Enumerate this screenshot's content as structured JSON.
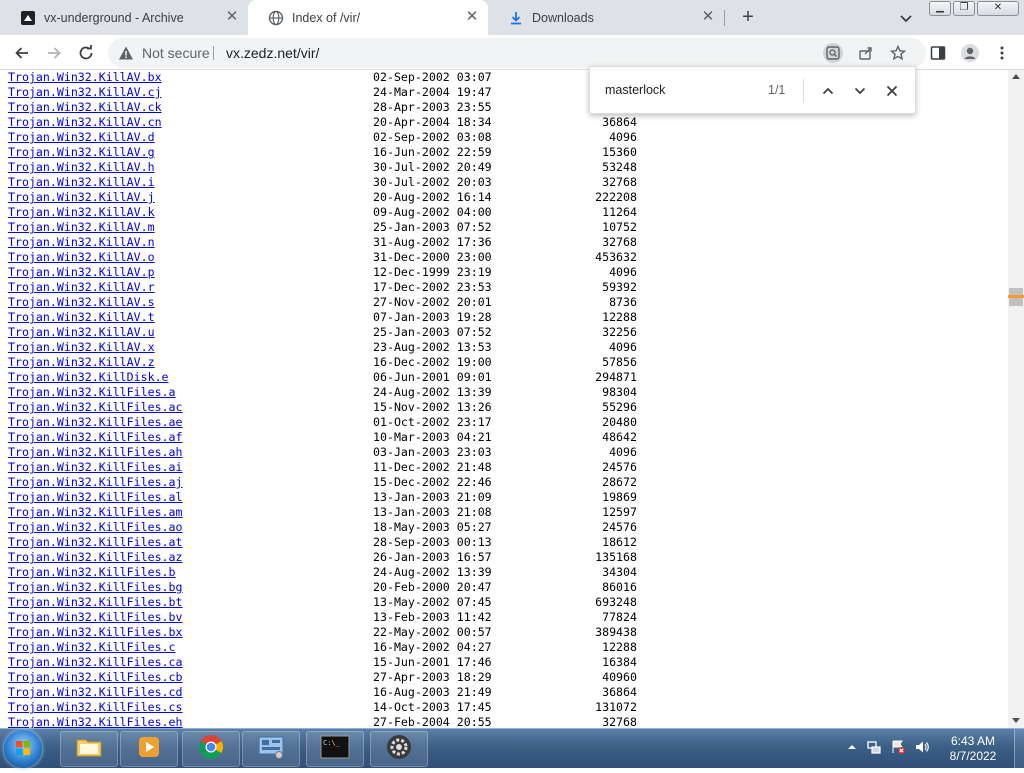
{
  "tabs": [
    {
      "title": "vx-underground - Archive",
      "icon": "vx-favicon",
      "active": false
    },
    {
      "title": "Index of /vir/",
      "icon": "globe-icon",
      "active": true
    },
    {
      "title": "Downloads",
      "icon": "download-icon",
      "active": false
    }
  ],
  "toolbar": {
    "security_text": "Not secure",
    "url": "vx.zedz.net/vir/"
  },
  "findbar": {
    "query": "masterlock",
    "count": "1/1"
  },
  "listing": [
    {
      "name": "Trojan.Win32.KillAV.bx",
      "date": "02-Sep-2002 03:07",
      "size": ""
    },
    {
      "name": "Trojan.Win32.KillAV.cj",
      "date": "24-Mar-2004 19:47",
      "size": ""
    },
    {
      "name": "Trojan.Win32.KillAV.ck",
      "date": "28-Apr-2003 23:55",
      "size": ""
    },
    {
      "name": "Trojan.Win32.KillAV.cn",
      "date": "20-Apr-2004 18:34",
      "size": "36864"
    },
    {
      "name": "Trojan.Win32.KillAV.d",
      "date": "02-Sep-2002 03:08",
      "size": "4096"
    },
    {
      "name": "Trojan.Win32.KillAV.g",
      "date": "16-Jun-2002 22:59",
      "size": "15360"
    },
    {
      "name": "Trojan.Win32.KillAV.h",
      "date": "30-Jul-2002 20:49",
      "size": "53248"
    },
    {
      "name": "Trojan.Win32.KillAV.i",
      "date": "30-Jul-2002 20:03",
      "size": "32768"
    },
    {
      "name": "Trojan.Win32.KillAV.j",
      "date": "20-Aug-2002 16:14",
      "size": "222208"
    },
    {
      "name": "Trojan.Win32.KillAV.k",
      "date": "09-Aug-2002 04:00",
      "size": "11264"
    },
    {
      "name": "Trojan.Win32.KillAV.m",
      "date": "25-Jan-2003 07:52",
      "size": "10752"
    },
    {
      "name": "Trojan.Win32.KillAV.n",
      "date": "31-Aug-2002 17:36",
      "size": "32768"
    },
    {
      "name": "Trojan.Win32.KillAV.o",
      "date": "31-Dec-2000 23:00",
      "size": "453632"
    },
    {
      "name": "Trojan.Win32.KillAV.p",
      "date": "12-Dec-1999 23:19",
      "size": "4096"
    },
    {
      "name": "Trojan.Win32.KillAV.r",
      "date": "17-Dec-2002 23:53",
      "size": "59392"
    },
    {
      "name": "Trojan.Win32.KillAV.s",
      "date": "27-Nov-2002 20:01",
      "size": "8736"
    },
    {
      "name": "Trojan.Win32.KillAV.t",
      "date": "07-Jan-2003 19:28",
      "size": "12288"
    },
    {
      "name": "Trojan.Win32.KillAV.u",
      "date": "25-Jan-2003 07:52",
      "size": "32256"
    },
    {
      "name": "Trojan.Win32.KillAV.x",
      "date": "23-Aug-2002 13:53",
      "size": "4096"
    },
    {
      "name": "Trojan.Win32.KillAV.z",
      "date": "16-Dec-2002 19:00",
      "size": "57856"
    },
    {
      "name": "Trojan.Win32.KillDisk.e",
      "date": "06-Jun-2001 09:01",
      "size": "294871"
    },
    {
      "name": "Trojan.Win32.KillFiles.a",
      "date": "24-Aug-2002 13:39",
      "size": "98304"
    },
    {
      "name": "Trojan.Win32.KillFiles.ac",
      "date": "15-Nov-2002 13:26",
      "size": "55296"
    },
    {
      "name": "Trojan.Win32.KillFiles.ae",
      "date": "01-Oct-2002 23:17",
      "size": "20480"
    },
    {
      "name": "Trojan.Win32.KillFiles.af",
      "date": "10-Mar-2003 04:21",
      "size": "48642"
    },
    {
      "name": "Trojan.Win32.KillFiles.ah",
      "date": "03-Jan-2003 23:03",
      "size": "4096"
    },
    {
      "name": "Trojan.Win32.KillFiles.ai",
      "date": "11-Dec-2002 21:48",
      "size": "24576"
    },
    {
      "name": "Trojan.Win32.KillFiles.aj",
      "date": "15-Dec-2002 22:46",
      "size": "28672"
    },
    {
      "name": "Trojan.Win32.KillFiles.al",
      "date": "13-Jan-2003 21:09",
      "size": "19869"
    },
    {
      "name": "Trojan.Win32.KillFiles.am",
      "date": "13-Jan-2003 21:08",
      "size": "12597"
    },
    {
      "name": "Trojan.Win32.KillFiles.ao",
      "date": "18-May-2003 05:27",
      "size": "24576"
    },
    {
      "name": "Trojan.Win32.KillFiles.at",
      "date": "28-Sep-2003 00:13",
      "size": "18612"
    },
    {
      "name": "Trojan.Win32.KillFiles.az",
      "date": "26-Jan-2003 16:57",
      "size": "135168"
    },
    {
      "name": "Trojan.Win32.KillFiles.b",
      "date": "24-Aug-2002 13:39",
      "size": "34304"
    },
    {
      "name": "Trojan.Win32.KillFiles.bg",
      "date": "20-Feb-2000 20:47",
      "size": "86016"
    },
    {
      "name": "Trojan.Win32.KillFiles.bt",
      "date": "13-May-2002 07:45",
      "size": "693248"
    },
    {
      "name": "Trojan.Win32.KillFiles.bv",
      "date": "13-Feb-2003 11:42",
      "size": "77824"
    },
    {
      "name": "Trojan.Win32.KillFiles.bx",
      "date": "22-May-2002 00:57",
      "size": "389438"
    },
    {
      "name": "Trojan.Win32.KillFiles.c",
      "date": "16-May-2002 04:27",
      "size": "12288"
    },
    {
      "name": "Trojan.Win32.KillFiles.ca",
      "date": "15-Jun-2001 17:46",
      "size": "16384"
    },
    {
      "name": "Trojan.Win32.KillFiles.cb",
      "date": "27-Apr-2003 18:29",
      "size": "40960"
    },
    {
      "name": "Trojan.Win32.KillFiles.cd",
      "date": "16-Aug-2003 21:49",
      "size": "36864"
    },
    {
      "name": "Trojan.Win32.KillFiles.cs",
      "date": "14-Oct-2003 17:45",
      "size": "131072"
    },
    {
      "name": "Trojan.Win32.KillFiles.eh",
      "date": "27-Feb-2004 20:55",
      "size": "32768"
    }
  ],
  "taskbar": {
    "apps": [
      "file-explorer",
      "media-player",
      "chrome",
      "control-panel",
      "command-prompt",
      "app-gear"
    ],
    "time": "6:43 AM",
    "date": "8/7/2022"
  },
  "colors": {
    "link": "#0000ee",
    "tabstrip": "#dee1e6",
    "find_highlight": "#ff9632"
  }
}
